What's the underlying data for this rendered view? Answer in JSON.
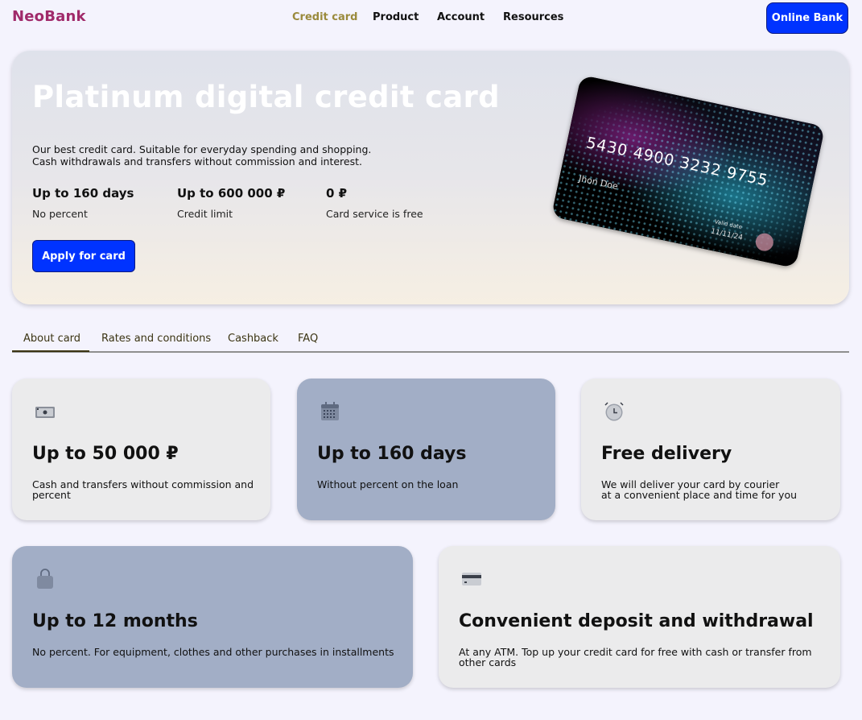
{
  "header": {
    "logo": "NeoBank",
    "nav": [
      "Credit card",
      "Product",
      "Account",
      "Resources"
    ],
    "active_nav": "Credit card",
    "online_bank": "Online Bank"
  },
  "hero": {
    "title": "Platinum digital credit card",
    "desc_line1": "Our best credit card. Suitable for everyday spending and shopping.",
    "desc_line2": "Cash withdrawals and transfers without commission and interest.",
    "stats": [
      {
        "value": "Up to 160 days",
        "label": "No percent"
      },
      {
        "value": "Up to 600 000 ₽",
        "label": "Credit limit"
      },
      {
        "value": "0 ₽",
        "label": "Card service is free"
      }
    ],
    "apply": "Apply for card",
    "card": {
      "number": "5430 4900 3232 9755",
      "holder": "Jhon Doe",
      "valid_label": "Valid date",
      "valid": "11/11/24"
    }
  },
  "tabs": [
    "About card",
    "Rates and conditions",
    "Cashback",
    "FAQ"
  ],
  "active_tab": "About card",
  "features": [
    {
      "icon": "cash-icon",
      "title": "Up to 50 000 ₽",
      "desc": "Cash and transfers without commission and percent"
    },
    {
      "icon": "calendar-icon",
      "title": "Up to 160 days",
      "desc": "Without percent on the loan"
    },
    {
      "icon": "alarm-clock-icon",
      "title": "Free delivery",
      "desc_line1": "We will deliver your card by courier",
      "desc_line2": "at a convenient place and time for you"
    },
    {
      "icon": "shopping-bag-icon",
      "title": "Up to 12 months",
      "desc": "No percent. For equipment, clothes and other purchases in installments"
    },
    {
      "icon": "credit-card-icon",
      "title": "Convenient deposit and withdrawal",
      "desc": "At any ATM. Top up your credit card for free with cash or transfer from other cards"
    }
  ]
}
